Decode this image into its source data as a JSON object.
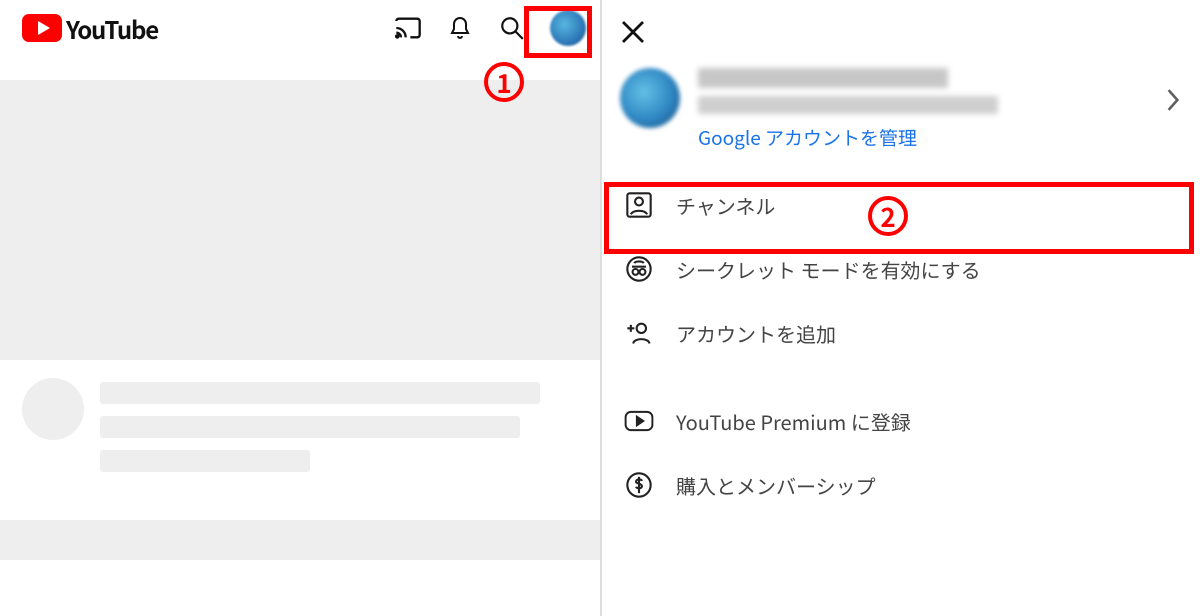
{
  "brand": {
    "name": "YouTube"
  },
  "account_panel": {
    "manage_link": "Google アカウントを管理",
    "menu": {
      "channel": "チャンネル",
      "incognito": "シークレット モードを有効にする",
      "add_account": "アカウントを追加",
      "premium": "YouTube Premium に登録",
      "purchases": "購入とメンバーシップ"
    }
  },
  "annotations": {
    "step1": "1",
    "step2": "2"
  }
}
